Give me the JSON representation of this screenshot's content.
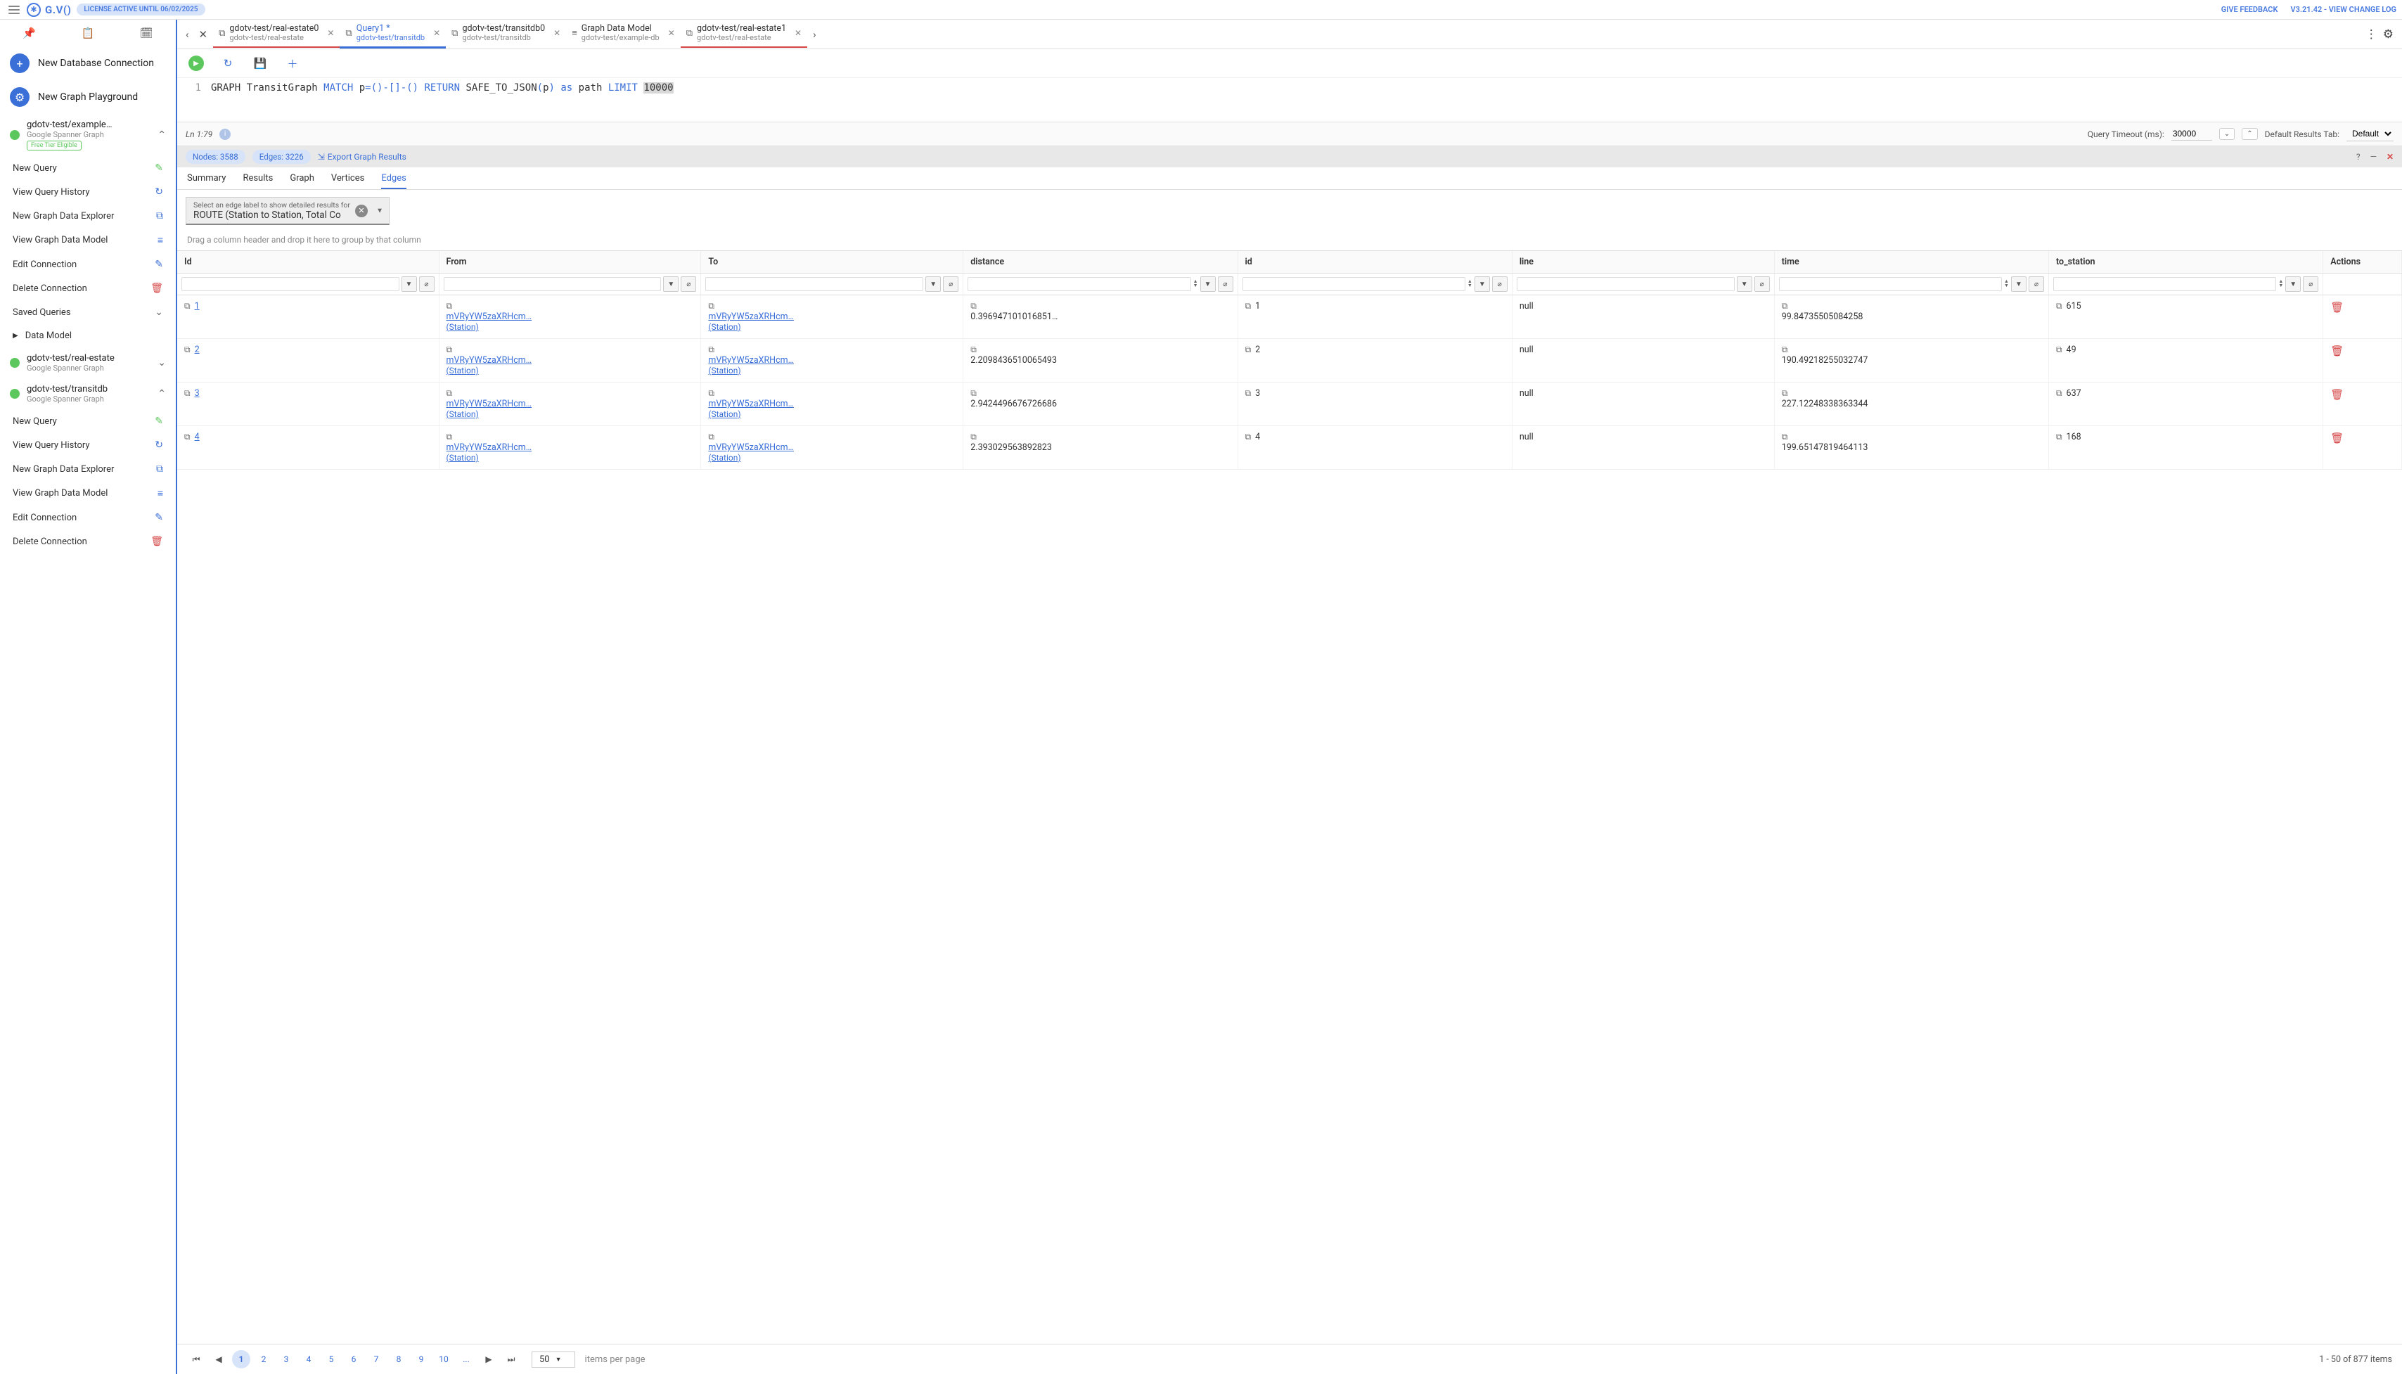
{
  "topbar": {
    "logo_text": "G.V()",
    "license": "LICENSE ACTIVE UNTIL 06/02/2025",
    "feedback": "GIVE FEEDBACK",
    "version": "V3.21.42 - VIEW CHANGE LOG"
  },
  "sidebar": {
    "new_db": "New Database Connection",
    "new_pg": "New Graph Playground",
    "connections": [
      {
        "name": "gdotv-test/example…",
        "sub": "Google Spanner Graph",
        "badge": "Free Tier Eligible",
        "expanded": true,
        "items": [
          {
            "label": "New Query",
            "icon": "wand",
            "color": "green"
          },
          {
            "label": "View Query History",
            "icon": "history",
            "color": "blue"
          },
          {
            "label": "New Graph Data Explorer",
            "icon": "explorer",
            "color": "blue"
          },
          {
            "label": "View Graph Data Model",
            "icon": "db",
            "color": "blue"
          },
          {
            "label": "Edit Connection",
            "icon": "edit",
            "color": "blue"
          },
          {
            "label": "Delete Connection",
            "icon": "trash",
            "color": "red"
          }
        ],
        "saved": "Saved Queries",
        "data_model": "Data Model"
      },
      {
        "name": "gdotv-test/real-estate",
        "sub": "Google Spanner Graph",
        "expanded": false
      },
      {
        "name": "gdotv-test/transitdb",
        "sub": "Google Spanner Graph",
        "expanded": true,
        "items": [
          {
            "label": "New Query",
            "icon": "wand",
            "color": "green"
          },
          {
            "label": "View Query History",
            "icon": "history",
            "color": "blue"
          },
          {
            "label": "New Graph Data Explorer",
            "icon": "explorer",
            "color": "blue"
          },
          {
            "label": "View Graph Data Model",
            "icon": "db",
            "color": "blue"
          },
          {
            "label": "Edit Connection",
            "icon": "edit",
            "color": "blue"
          },
          {
            "label": "Delete Connection",
            "icon": "trash",
            "color": "red"
          }
        ]
      }
    ]
  },
  "tabs": {
    "list": [
      {
        "title": "gdotv-test/real-estate0",
        "sub": "gdotv-test/real-estate",
        "redline": true
      },
      {
        "title": "Query1 *",
        "sub": "gdotv-test/transitdb",
        "active": true,
        "dirty": true
      },
      {
        "title": "gdotv-test/transitdb0",
        "sub": "gdotv-test/transitdb"
      },
      {
        "title": "Graph Data Model",
        "sub": "gdotv-test/example-db",
        "icon": "db"
      },
      {
        "title": "gdotv-test/real-estate1",
        "sub": "gdotv-test/real-estate",
        "redline": true
      }
    ]
  },
  "editor": {
    "line_no": "1",
    "tokens": {
      "t0": "GRAPH TransitGraph ",
      "t1": "MATCH",
      "t2": " p",
      "t3": "=()-[]-()",
      "t4": " RETURN",
      "t5": " SAFE_TO_JSON",
      "t6": "(",
      "t7": "p",
      "t8": ")",
      "t9": " as",
      "t10": " path ",
      "t11": "LIMIT",
      "t12": " ",
      "t13": "10000"
    }
  },
  "status": {
    "pos": "Ln 1:79",
    "timeout_label": "Query Timeout (ms):",
    "timeout_val": "30000",
    "default_tab_label": "Default Results Tab:",
    "default_tab_val": "Default"
  },
  "results": {
    "nodes": "Nodes: 3588",
    "edges": "Edges: 3226",
    "export": "Export Graph Results",
    "tabs": [
      "Summary",
      "Results",
      "Graph",
      "Vertices",
      "Edges"
    ],
    "active_tab": "Edges",
    "filter_label": "Select an edge label to show detailed results for",
    "filter_value": "ROUTE (Station to Station, Total Co",
    "group_hint": "Drag a column header and drop it here to group by that column",
    "columns": [
      "Id",
      "From",
      "To",
      "distance",
      "id",
      "line",
      "time",
      "to_station",
      "Actions"
    ],
    "rows": [
      {
        "n": "1",
        "from": "mVRyYW5zaXRHcm…",
        "from_t": "(Station)",
        "to": "mVRyYW5zaXRHcm…",
        "to_t": "(Station)",
        "dist": "0.396947101016851…",
        "id": "1",
        "line": "null",
        "time": "99.84735505084258",
        "tos": "615"
      },
      {
        "n": "2",
        "from": "mVRyYW5zaXRHcm…",
        "from_t": "(Station)",
        "to": "mVRyYW5zaXRHcm…",
        "to_t": "(Station)",
        "dist": "2.2098436510065493",
        "id": "2",
        "line": "null",
        "time": "190.49218255032747",
        "tos": "49"
      },
      {
        "n": "3",
        "from": "mVRyYW5zaXRHcm…",
        "from_t": "(Station)",
        "to": "mVRyYW5zaXRHcm…",
        "to_t": "(Station)",
        "dist": "2.9424496676726686",
        "id": "3",
        "line": "null",
        "time": "227.12248338363344",
        "tos": "637"
      },
      {
        "n": "4",
        "from": "mVRyYW5zaXRHcm…",
        "from_t": "(Station)",
        "to": "mVRyYW5zaXRHcm…",
        "to_t": "(Station)",
        "dist": "2.393029563892823",
        "id": "4",
        "line": "null",
        "time": "199.65147819464113",
        "tos": "168"
      }
    ]
  },
  "pager": {
    "pages": [
      "1",
      "2",
      "3",
      "4",
      "5",
      "6",
      "7",
      "8",
      "9",
      "10",
      "..."
    ],
    "active": "1",
    "size": "50",
    "size_label": "items per page",
    "info": "1 - 50 of 877 items"
  }
}
